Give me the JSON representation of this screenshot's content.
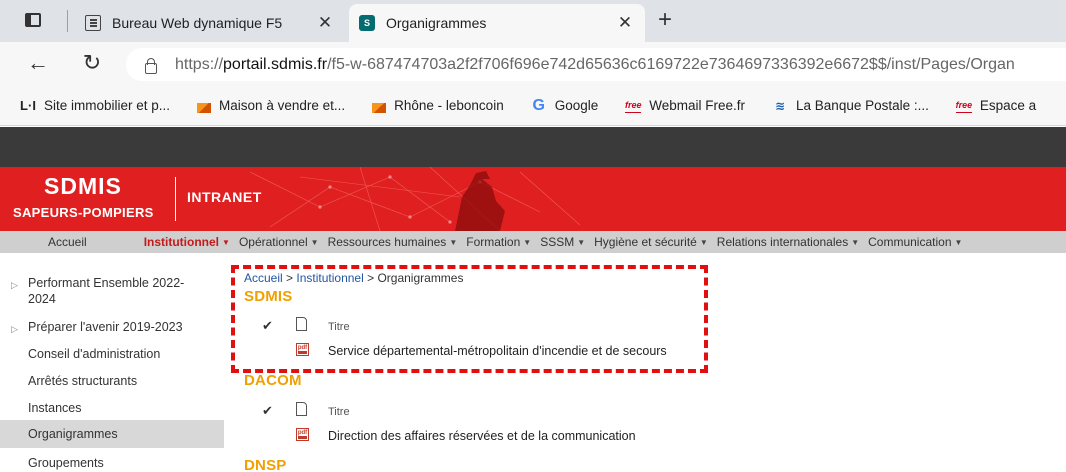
{
  "browser": {
    "tabs": [
      {
        "title": "Bureau Web dynamique F5",
        "active": false
      },
      {
        "title": "Organigrammes",
        "active": true
      }
    ],
    "url_prefix": "https://",
    "url_domain": "portail.sdmis.fr",
    "url_rest": "/f5-w-687474703a2f2f706f696e742d65636c6169722e7364697336392e6672$$/inst/Pages/Organ",
    "bookmarks": [
      {
        "label": "Site immobilier et p...",
        "icon": "li-icon"
      },
      {
        "label": "Maison à vendre et...",
        "icon": "orange-tag-icon"
      },
      {
        "label": "Rhône - leboncoin",
        "icon": "orange-tag-icon"
      },
      {
        "label": "Google",
        "icon": "google-icon"
      },
      {
        "label": "Webmail Free.fr",
        "icon": "free-icon"
      },
      {
        "label": "La Banque Postale :...",
        "icon": "bank-icon"
      },
      {
        "label": "Espace a",
        "icon": "free-icon"
      }
    ]
  },
  "header": {
    "logo_main": "SDMIS",
    "logo_sub": "SAPEURS-POMPIERS",
    "logo_right": "INTRANET"
  },
  "topnav": [
    {
      "label": "Accueil",
      "caret": false,
      "current": false
    },
    {
      "label": "Institutionnel",
      "caret": true,
      "current": true
    },
    {
      "label": "Opérationnel",
      "caret": true,
      "current": false
    },
    {
      "label": "Ressources humaines",
      "caret": true,
      "current": false
    },
    {
      "label": "Formation",
      "caret": true,
      "current": false
    },
    {
      "label": "SSSM",
      "caret": true,
      "current": false
    },
    {
      "label": "Hygiène et sécurité",
      "caret": true,
      "current": false
    },
    {
      "label": "Relations internationales",
      "caret": true,
      "current": false
    },
    {
      "label": "Communication",
      "caret": true,
      "current": false
    }
  ],
  "leftnav": [
    {
      "label_line1": "Performant Ensemble 2022-",
      "label_line2": "2024",
      "expandable": true
    },
    {
      "label_line1": "Préparer l'avenir 2019-2023",
      "expandable": true
    },
    {
      "label_line1": "Conseil d'administration"
    },
    {
      "label_line1": "Arrêtés structurants"
    },
    {
      "label_line1": "Instances"
    },
    {
      "label_line1": "Organigrammes",
      "selected": true
    },
    {
      "label_line1": "Groupements"
    }
  ],
  "breadcrumb": {
    "home": "Accueil",
    "sep1": " > ",
    "parent": "Institutionnel",
    "sep2": " > ",
    "current": "Organigrammes"
  },
  "sections": [
    {
      "title": "SDMIS",
      "column_header": "Titre",
      "documents": [
        "Service départemental-métropolitain d'incendie et de secours"
      ]
    },
    {
      "title": "DACOM",
      "column_header": "Titre",
      "documents": [
        "Direction des affaires réservées et de la communication"
      ]
    },
    {
      "title": "DNSP",
      "column_header": "",
      "documents": []
    }
  ],
  "colors": {
    "banner_red": "#e02020",
    "section_title": "#f0a000",
    "highlight_dash": "#e01010",
    "nav_current": "#c41a1a"
  }
}
